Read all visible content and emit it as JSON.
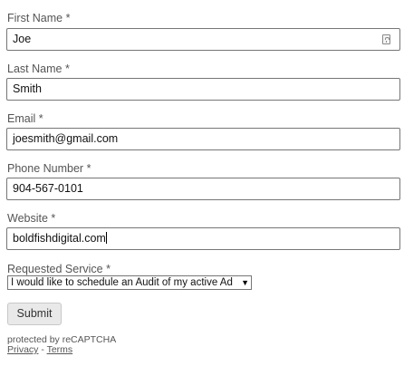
{
  "form": {
    "first_name": {
      "label": "First Name",
      "required_mark": "*",
      "value": "Joe"
    },
    "last_name": {
      "label": "Last Name",
      "required_mark": "*",
      "value": "Smith"
    },
    "email": {
      "label": "Email",
      "required_mark": "*",
      "value": "joesmith@gmail.com"
    },
    "phone": {
      "label": "Phone Number",
      "required_mark": "*",
      "value": "904-567-0101"
    },
    "website": {
      "label": "Website",
      "required_mark": "*",
      "value": "boldfishdigital.com"
    },
    "service": {
      "label": "Requested Service",
      "required_mark": "*",
      "selected": "I would like to schedule an Audit of my active Ad Accounts",
      "arrow": "▼"
    },
    "submit_label": "Submit"
  },
  "recaptcha": {
    "line1": "protected by reCAPTCHA",
    "privacy_label": "Privacy",
    "separator": " - ",
    "terms_label": "Terms"
  },
  "icons": {
    "autofill": "contact-autofill-icon"
  },
  "colors": {
    "input_border": "#767676",
    "label_text": "#555555",
    "button_bg": "#e9e9e9"
  }
}
